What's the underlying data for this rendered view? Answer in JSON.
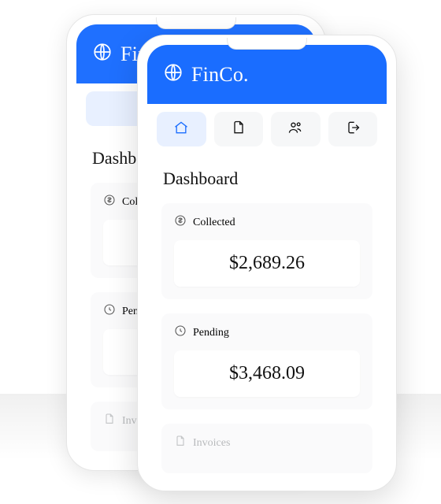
{
  "app": {
    "title": "FinCo."
  },
  "nav": {
    "items": [
      {
        "name": "home"
      },
      {
        "name": "documents"
      },
      {
        "name": "users"
      },
      {
        "name": "logout"
      }
    ]
  },
  "dashboard": {
    "title": "Dashboard",
    "cards": {
      "collected": {
        "label": "Collected",
        "value": "$2,689.26"
      },
      "pending": {
        "label": "Pending",
        "value": "$3,468.09"
      },
      "invoices": {
        "label": "Invoices"
      }
    }
  },
  "back_phone": {
    "dashboard_title_truncated": "Dashboar",
    "collected_label_truncated": "Collecte",
    "pending_label": "Pending",
    "invoices_label": "Invoices"
  }
}
